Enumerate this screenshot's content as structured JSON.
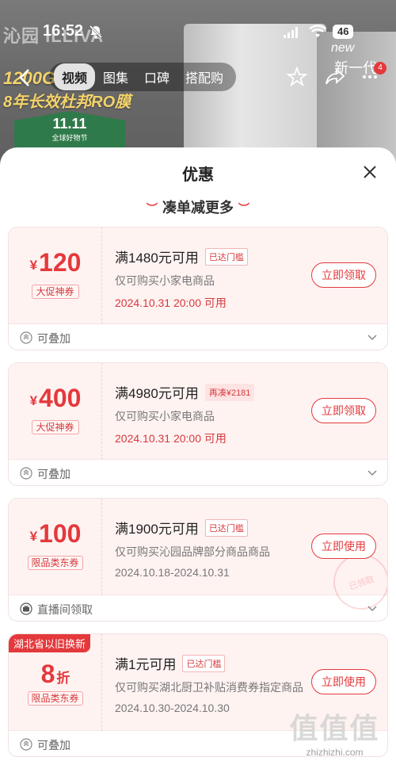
{
  "status_bar": {
    "time": "16:52",
    "battery": "46"
  },
  "background": {
    "brand": "沁园 ILLIVA",
    "promo_line1": "1200G",
    "promo_line2": "8年长效杜邦RO膜",
    "event_big": "11.11",
    "event_small": "全球好物节",
    "new_text": "new",
    "new_cn": "新一代",
    "more_badge": "4"
  },
  "nav": {
    "tabs": [
      {
        "label": "视频",
        "active": true
      },
      {
        "label": "图集",
        "active": false
      },
      {
        "label": "口碑",
        "active": false
      },
      {
        "label": "搭配购",
        "active": false
      }
    ]
  },
  "sheet": {
    "title": "优惠",
    "subtitle": "凑单减更多"
  },
  "coupons": [
    {
      "currency": "¥",
      "amount": "120",
      "unit": "",
      "tag": "大促神券",
      "condition": "满1480元可用",
      "badge": "已达门槛",
      "scope": "仅可购买小家电商品",
      "time": "2024.10.31 20:00 可用",
      "button": "立即领取",
      "footer": "可叠加"
    },
    {
      "currency": "¥",
      "amount": "400",
      "unit": "",
      "tag": "大促神券",
      "condition": "满4980元可用",
      "badge": "再凑¥2181",
      "scope": "仅可购买小家电商品",
      "time": "2024.10.31 20:00 可用",
      "button": "立即领取",
      "footer": "可叠加"
    },
    {
      "currency": "¥",
      "amount": "100",
      "unit": "",
      "tag": "限品类东券",
      "condition": "满1900元可用",
      "badge": "已达门槛",
      "scope": "仅可购买沁园品牌部分商品商品",
      "time": "2024.10.18-2024.10.31",
      "button": "立即使用",
      "stamp": "已领取",
      "footer": "直播间领取"
    },
    {
      "ribbon": "湖北省以旧换新",
      "currency": "",
      "amount": "8",
      "unit": "折",
      "tag": "限品类东券",
      "condition": "满1元可用",
      "badge": "已达门槛",
      "scope": "仅可购买湖北厨卫补贴消费券指定商品",
      "time": "2024.10.30-2024.10.30",
      "button": "立即使用",
      "footer": "可叠加"
    }
  ],
  "watermark": {
    "logo": "值值值",
    "url": "zhizhizhi.com"
  },
  "colors": {
    "accent": "#e4393c",
    "coupon_bg": "#fff3f2"
  }
}
